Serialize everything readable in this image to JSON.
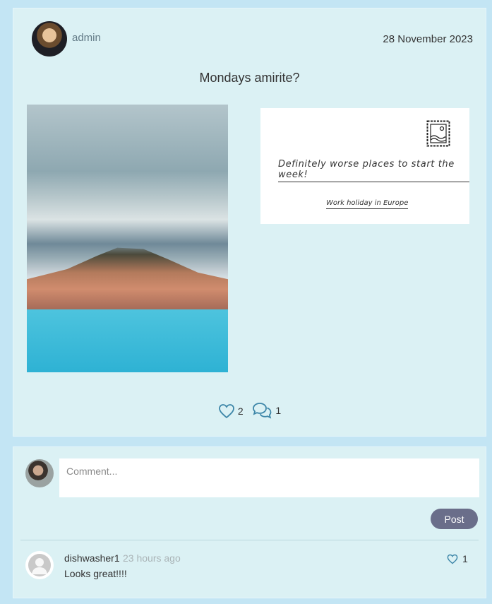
{
  "post": {
    "author": "admin",
    "date": "28 November 2023",
    "title": "Mondays amirite?",
    "postcard": {
      "message": "Definitely worse places to start the week!",
      "caption": "Work holiday in Europe"
    },
    "likes": "2",
    "comments_count": "1",
    "icons": {
      "like": "heart-icon",
      "comment": "chat-bubbles-icon",
      "stamp": "postage-stamp-icon"
    }
  },
  "comment_form": {
    "placeholder": "Comment...",
    "submit_label": "Post"
  },
  "comments": [
    {
      "author": "dishwasher1",
      "time": "23 hours ago",
      "body": "Looks great!!!!",
      "likes": "1"
    }
  ],
  "colors": {
    "page_bg": "#c3e5f4",
    "card_bg": "#dbf1f4",
    "accent": "#3d86a8",
    "button": "#6a6e8a"
  }
}
